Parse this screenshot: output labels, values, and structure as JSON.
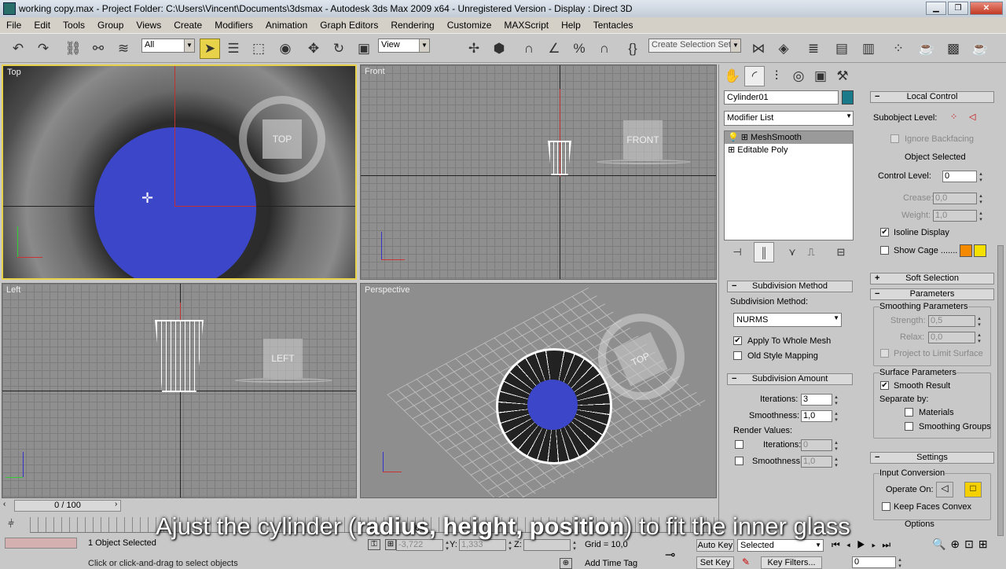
{
  "window": {
    "title": "working copy.max      - Project Folder: C:\\Users\\Vincent\\Documents\\3dsmax      - Autodesk 3ds Max  2009 x64    - Unregistered Version       - Display : Direct 3D"
  },
  "menu": [
    "File",
    "Edit",
    "Tools",
    "Group",
    "Views",
    "Create",
    "Modifiers",
    "Animation",
    "Graph Editors",
    "Rendering",
    "Customize",
    "MAXScript",
    "Help",
    "Tentacles"
  ],
  "toolbar": {
    "filter": "All",
    "ref_coord": "View",
    "selection_set": "Create Selection Set"
  },
  "viewports": {
    "top": "Top",
    "front": "Front",
    "left": "Left",
    "perspective": "Perspective"
  },
  "viewcube": {
    "top": "TOP",
    "front": "FRONT",
    "left": "LEFT",
    "persp": "TOP"
  },
  "panel": {
    "object_name": "Cylinder01",
    "object_color": "#1a7a8a",
    "modifier_list": "Modifier List",
    "stack": [
      "MeshSmooth",
      "Editable Poly"
    ],
    "subdivision_method": {
      "header": "Subdivision Method",
      "label": "Subdivision Method:",
      "value": "NURMS",
      "apply_whole": "Apply To Whole Mesh",
      "apply_whole_checked": "✔",
      "old_style": "Old Style Mapping"
    },
    "subdivision_amount": {
      "header": "Subdivision Amount",
      "iterations_label": "Iterations:",
      "iterations": "3",
      "smoothness_label": "Smoothness:",
      "smoothness": "1,0",
      "render_values": "Render Values:",
      "r_iterations_label": "Iterations:",
      "r_iterations": "0",
      "r_smoothness_label": "Smoothness:",
      "r_smoothness": "1,0"
    },
    "local_control": {
      "header": "Local Control",
      "subobject": "Subobject Level:",
      "ignore_backfacing": "Ignore Backfacing",
      "object_selected": "Object Selected",
      "control_level_label": "Control Level:",
      "control_level": "0",
      "crease_label": "Crease:",
      "crease": "0,0",
      "weight_label": "Weight:",
      "weight": "1,0",
      "isoline": "Isoline Display",
      "isoline_checked": "✔",
      "show_cage": "Show Cage ......."
    },
    "soft_selection": "Soft Selection",
    "parameters": {
      "header": "Parameters",
      "smoothing": "Smoothing Parameters",
      "strength_label": "Strength:",
      "strength": "0,5",
      "relax_label": "Relax:",
      "relax": "0,0",
      "project_limit": "Project to Limit Surface",
      "surface": "Surface Parameters",
      "smooth_result": "Smooth Result",
      "smooth_result_checked": "✔",
      "separate_by": "Separate by:",
      "materials": "Materials",
      "smoothing_groups": "Smoothing Groups"
    },
    "settings": {
      "header": "Settings",
      "input_conversion": "Input Conversion",
      "operate_on": "Operate On:",
      "keep_faces": "Keep Faces Convex",
      "options": "Options"
    }
  },
  "status": {
    "time": "0 / 100",
    "selected": "1 Object Selected",
    "prompt": "Click or click-and-drag to select objects",
    "x_label": "X:",
    "x": "-3,722",
    "y_label": "Y:",
    "y": "1,333",
    "z_label": "Z:",
    "grid": "Grid = 10,0",
    "add_time_tag": "Add Time Tag",
    "auto_key": "Auto Key",
    "set_key": "Set Key",
    "key_mode": "Selected",
    "key_filters": "Key Filters...",
    "frame": "0",
    "ruler_mark": "60"
  },
  "subtitle": {
    "pre": "Ajust the cylinder (",
    "bold": "radius, height, position",
    "post": ") to fit the inner glass"
  }
}
